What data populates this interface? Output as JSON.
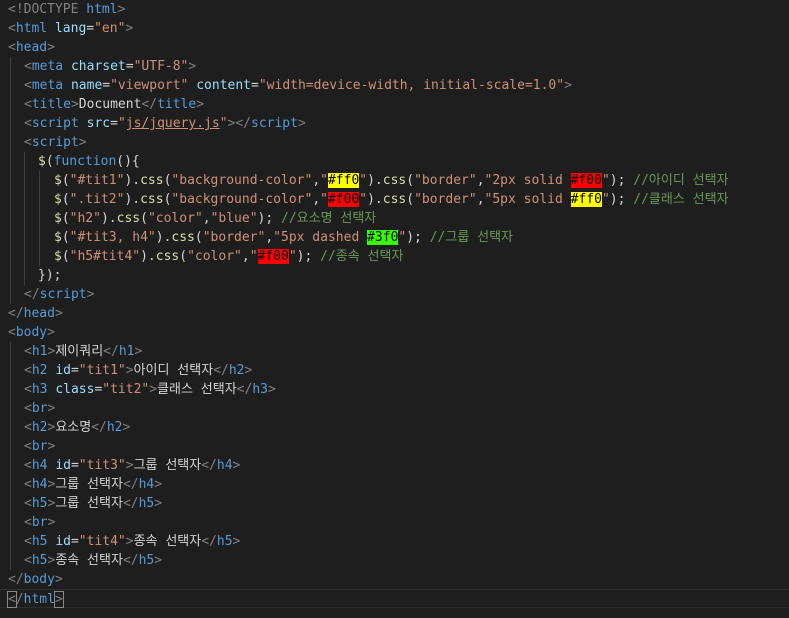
{
  "editor": {
    "lines": [
      [
        {
          "t": "<!DOCTYPE ",
          "c": "br"
        },
        {
          "t": "html",
          "c": "tag"
        },
        {
          "t": ">",
          "c": "br"
        }
      ],
      [
        {
          "t": "<",
          "c": "br"
        },
        {
          "t": "html",
          "c": "tag"
        },
        {
          "t": " ",
          "c": "txt"
        },
        {
          "t": "lang",
          "c": "attr"
        },
        {
          "t": "=",
          "c": "txt"
        },
        {
          "t": "\"en\"",
          "c": "str"
        },
        {
          "t": ">",
          "c": "br"
        }
      ],
      [
        {
          "t": "<",
          "c": "br"
        },
        {
          "t": "head",
          "c": "tag"
        },
        {
          "t": ">",
          "c": "br"
        }
      ],
      [
        {
          "t": "<",
          "c": "br"
        },
        {
          "t": "meta",
          "c": "tag"
        },
        {
          "t": " ",
          "c": "txt"
        },
        {
          "t": "charset",
          "c": "attr"
        },
        {
          "t": "=",
          "c": "txt"
        },
        {
          "t": "\"UTF-8\"",
          "c": "str"
        },
        {
          "t": ">",
          "c": "br"
        }
      ],
      [
        {
          "t": "<",
          "c": "br"
        },
        {
          "t": "meta",
          "c": "tag"
        },
        {
          "t": " ",
          "c": "txt"
        },
        {
          "t": "name",
          "c": "attr"
        },
        {
          "t": "=",
          "c": "txt"
        },
        {
          "t": "\"viewport\"",
          "c": "str"
        },
        {
          "t": " ",
          "c": "txt"
        },
        {
          "t": "content",
          "c": "attr"
        },
        {
          "t": "=",
          "c": "txt"
        },
        {
          "t": "\"width=device-width, initial-scale=1.0\"",
          "c": "str"
        },
        {
          "t": ">",
          "c": "br"
        }
      ],
      [
        {
          "t": "<",
          "c": "br"
        },
        {
          "t": "title",
          "c": "tag"
        },
        {
          "t": ">",
          "c": "br"
        },
        {
          "t": "Document",
          "c": "txt"
        },
        {
          "t": "</",
          "c": "br"
        },
        {
          "t": "title",
          "c": "tag"
        },
        {
          "t": ">",
          "c": "br"
        }
      ],
      [
        {
          "t": "<",
          "c": "br"
        },
        {
          "t": "script",
          "c": "tag"
        },
        {
          "t": " ",
          "c": "txt"
        },
        {
          "t": "src",
          "c": "attr"
        },
        {
          "t": "=",
          "c": "txt"
        },
        {
          "t": "\"",
          "c": "str"
        },
        {
          "t": "js/jquery.js",
          "c": "link"
        },
        {
          "t": "\"",
          "c": "str"
        },
        {
          "t": "></",
          "c": "br"
        },
        {
          "t": "script",
          "c": "tag"
        },
        {
          "t": ">",
          "c": "br"
        }
      ],
      [
        {
          "t": "<",
          "c": "br"
        },
        {
          "t": "script",
          "c": "tag"
        },
        {
          "t": ">",
          "c": "br"
        }
      ],
      [
        {
          "t": "$",
          "c": "fn"
        },
        {
          "t": "(",
          "c": "txt"
        },
        {
          "t": "function",
          "c": "kw"
        },
        {
          "t": "(){",
          "c": "txt"
        }
      ],
      [
        {
          "t": "$",
          "c": "fn"
        },
        {
          "t": "(",
          "c": "txt"
        },
        {
          "t": "\"#tit1\"",
          "c": "str"
        },
        {
          "t": ").",
          "c": "txt"
        },
        {
          "t": "css",
          "c": "fn"
        },
        {
          "t": "(",
          "c": "txt"
        },
        {
          "t": "\"background-color\"",
          "c": "str"
        },
        {
          "t": ",",
          "c": "txt"
        },
        {
          "t": "\"",
          "c": "str"
        },
        {
          "t": "#ff0",
          "c": "sw",
          "bg": "#ffff00",
          "fg": "#000000"
        },
        {
          "t": "\"",
          "c": "str"
        },
        {
          "t": ").",
          "c": "txt"
        },
        {
          "t": "css",
          "c": "fn"
        },
        {
          "t": "(",
          "c": "txt"
        },
        {
          "t": "\"border\"",
          "c": "str"
        },
        {
          "t": ",",
          "c": "txt"
        },
        {
          "t": "\"2px solid ",
          "c": "str"
        },
        {
          "t": "#f00",
          "c": "sw",
          "bg": "#ff0000",
          "fg": "#000000"
        },
        {
          "t": "\"",
          "c": "str"
        },
        {
          "t": "); ",
          "c": "txt"
        },
        {
          "t": "//아이디 선택자",
          "c": "cmt"
        }
      ],
      [
        {
          "t": "$",
          "c": "fn"
        },
        {
          "t": "(",
          "c": "txt"
        },
        {
          "t": "\".tit2\"",
          "c": "str"
        },
        {
          "t": ").",
          "c": "txt"
        },
        {
          "t": "css",
          "c": "fn"
        },
        {
          "t": "(",
          "c": "txt"
        },
        {
          "t": "\"background-color\"",
          "c": "str"
        },
        {
          "t": ",",
          "c": "txt"
        },
        {
          "t": "\"",
          "c": "str"
        },
        {
          "t": "#f00",
          "c": "sw",
          "bg": "#ff0000",
          "fg": "#000000"
        },
        {
          "t": "\"",
          "c": "str"
        },
        {
          "t": ").",
          "c": "txt"
        },
        {
          "t": "css",
          "c": "fn"
        },
        {
          "t": "(",
          "c": "txt"
        },
        {
          "t": "\"border\"",
          "c": "str"
        },
        {
          "t": ",",
          "c": "txt"
        },
        {
          "t": "\"5px solid ",
          "c": "str"
        },
        {
          "t": "#ff0",
          "c": "sw",
          "bg": "#ffff00",
          "fg": "#000000"
        },
        {
          "t": "\"",
          "c": "str"
        },
        {
          "t": "); ",
          "c": "txt"
        },
        {
          "t": "//클래스 선택자",
          "c": "cmt"
        }
      ],
      [
        {
          "t": "$",
          "c": "fn"
        },
        {
          "t": "(",
          "c": "txt"
        },
        {
          "t": "\"h2\"",
          "c": "str"
        },
        {
          "t": ").",
          "c": "txt"
        },
        {
          "t": "css",
          "c": "fn"
        },
        {
          "t": "(",
          "c": "txt"
        },
        {
          "t": "\"color\"",
          "c": "str"
        },
        {
          "t": ",",
          "c": "txt"
        },
        {
          "t": "\"blue\"",
          "c": "str"
        },
        {
          "t": "); ",
          "c": "txt"
        },
        {
          "t": "//요소명 선택자",
          "c": "cmt"
        }
      ],
      [
        {
          "t": "$",
          "c": "fn"
        },
        {
          "t": "(",
          "c": "txt"
        },
        {
          "t": "\"#tit3, h4\"",
          "c": "str"
        },
        {
          "t": ").",
          "c": "txt"
        },
        {
          "t": "css",
          "c": "fn"
        },
        {
          "t": "(",
          "c": "txt"
        },
        {
          "t": "\"border\"",
          "c": "str"
        },
        {
          "t": ",",
          "c": "txt"
        },
        {
          "t": "\"5px dashed ",
          "c": "str"
        },
        {
          "t": "#3f0",
          "c": "sw",
          "bg": "#33ff00",
          "fg": "#000000"
        },
        {
          "t": "\"",
          "c": "str"
        },
        {
          "t": "); ",
          "c": "txt"
        },
        {
          "t": "//그룹 선택자",
          "c": "cmt"
        }
      ],
      [
        {
          "t": "$",
          "c": "fn"
        },
        {
          "t": "(",
          "c": "txt"
        },
        {
          "t": "\"h5#tit4\"",
          "c": "str"
        },
        {
          "t": ").",
          "c": "txt"
        },
        {
          "t": "css",
          "c": "fn"
        },
        {
          "t": "(",
          "c": "txt"
        },
        {
          "t": "\"color\"",
          "c": "str"
        },
        {
          "t": ",",
          "c": "txt"
        },
        {
          "t": "\"",
          "c": "str"
        },
        {
          "t": "#f00",
          "c": "sw",
          "bg": "#ff0000",
          "fg": "#000000"
        },
        {
          "t": "\"",
          "c": "str"
        },
        {
          "t": "); ",
          "c": "txt"
        },
        {
          "t": "//종속 선택자",
          "c": "cmt"
        }
      ],
      [
        {
          "t": "});",
          "c": "txt"
        }
      ],
      [
        {
          "t": "</",
          "c": "br"
        },
        {
          "t": "script",
          "c": "tag"
        },
        {
          "t": ">",
          "c": "br"
        }
      ],
      [
        {
          "t": "</",
          "c": "br"
        },
        {
          "t": "head",
          "c": "tag"
        },
        {
          "t": ">",
          "c": "br"
        }
      ],
      [
        {
          "t": "<",
          "c": "br"
        },
        {
          "t": "body",
          "c": "tag"
        },
        {
          "t": ">",
          "c": "br"
        }
      ],
      [
        {
          "t": "<",
          "c": "br"
        },
        {
          "t": "h1",
          "c": "tag"
        },
        {
          "t": ">",
          "c": "br"
        },
        {
          "t": "제이쿼리",
          "c": "txt"
        },
        {
          "t": "</",
          "c": "br"
        },
        {
          "t": "h1",
          "c": "tag"
        },
        {
          "t": ">",
          "c": "br"
        }
      ],
      [
        {
          "t": "<",
          "c": "br"
        },
        {
          "t": "h2",
          "c": "tag"
        },
        {
          "t": " ",
          "c": "txt"
        },
        {
          "t": "id",
          "c": "attr"
        },
        {
          "t": "=",
          "c": "txt"
        },
        {
          "t": "\"tit1\"",
          "c": "str"
        },
        {
          "t": ">",
          "c": "br"
        },
        {
          "t": "아이디 선택자",
          "c": "txt"
        },
        {
          "t": "</",
          "c": "br"
        },
        {
          "t": "h2",
          "c": "tag"
        },
        {
          "t": ">",
          "c": "br"
        }
      ],
      [
        {
          "t": "<",
          "c": "br"
        },
        {
          "t": "h3",
          "c": "tag"
        },
        {
          "t": " ",
          "c": "txt"
        },
        {
          "t": "class",
          "c": "attr"
        },
        {
          "t": "=",
          "c": "txt"
        },
        {
          "t": "\"tit2\"",
          "c": "str"
        },
        {
          "t": ">",
          "c": "br"
        },
        {
          "t": "클래스 선택자",
          "c": "txt"
        },
        {
          "t": "</",
          "c": "br"
        },
        {
          "t": "h3",
          "c": "tag"
        },
        {
          "t": ">",
          "c": "br"
        }
      ],
      [
        {
          "t": "<",
          "c": "br"
        },
        {
          "t": "br",
          "c": "tag"
        },
        {
          "t": ">",
          "c": "br"
        }
      ],
      [
        {
          "t": "<",
          "c": "br"
        },
        {
          "t": "h2",
          "c": "tag"
        },
        {
          "t": ">",
          "c": "br"
        },
        {
          "t": "요소명",
          "c": "txt"
        },
        {
          "t": "</",
          "c": "br"
        },
        {
          "t": "h2",
          "c": "tag"
        },
        {
          "t": ">",
          "c": "br"
        }
      ],
      [
        {
          "t": "<",
          "c": "br"
        },
        {
          "t": "br",
          "c": "tag"
        },
        {
          "t": ">",
          "c": "br"
        }
      ],
      [
        {
          "t": "<",
          "c": "br"
        },
        {
          "t": "h4",
          "c": "tag"
        },
        {
          "t": " ",
          "c": "txt"
        },
        {
          "t": "id",
          "c": "attr"
        },
        {
          "t": "=",
          "c": "txt"
        },
        {
          "t": "\"tit3\"",
          "c": "str"
        },
        {
          "t": ">",
          "c": "br"
        },
        {
          "t": "그룹 선택자",
          "c": "txt"
        },
        {
          "t": "</",
          "c": "br"
        },
        {
          "t": "h4",
          "c": "tag"
        },
        {
          "t": ">",
          "c": "br"
        }
      ],
      [
        {
          "t": "<",
          "c": "br"
        },
        {
          "t": "h4",
          "c": "tag"
        },
        {
          "t": ">",
          "c": "br"
        },
        {
          "t": "그룹 선택자",
          "c": "txt"
        },
        {
          "t": "</",
          "c": "br"
        },
        {
          "t": "h4",
          "c": "tag"
        },
        {
          "t": ">",
          "c": "br"
        }
      ],
      [
        {
          "t": "<",
          "c": "br"
        },
        {
          "t": "h5",
          "c": "tag"
        },
        {
          "t": ">",
          "c": "br"
        },
        {
          "t": "그룹 선택자",
          "c": "txt"
        },
        {
          "t": "</",
          "c": "br"
        },
        {
          "t": "h5",
          "c": "tag"
        },
        {
          "t": ">",
          "c": "br"
        }
      ],
      [
        {
          "t": "<",
          "c": "br"
        },
        {
          "t": "br",
          "c": "tag"
        },
        {
          "t": ">",
          "c": "br"
        }
      ],
      [
        {
          "t": "<",
          "c": "br"
        },
        {
          "t": "h5",
          "c": "tag"
        },
        {
          "t": " ",
          "c": "txt"
        },
        {
          "t": "id",
          "c": "attr"
        },
        {
          "t": "=",
          "c": "txt"
        },
        {
          "t": "\"tit4\"",
          "c": "str"
        },
        {
          "t": ">",
          "c": "br"
        },
        {
          "t": "종속 선택자",
          "c": "txt"
        },
        {
          "t": "</",
          "c": "br"
        },
        {
          "t": "h5",
          "c": "tag"
        },
        {
          "t": ">",
          "c": "br"
        }
      ],
      [
        {
          "t": "<",
          "c": "br"
        },
        {
          "t": "h5",
          "c": "tag"
        },
        {
          "t": ">",
          "c": "br"
        },
        {
          "t": "종속 선택자",
          "c": "txt"
        },
        {
          "t": "</",
          "c": "br"
        },
        {
          "t": "h5",
          "c": "tag"
        },
        {
          "t": ">",
          "c": "br"
        }
      ],
      [
        {
          "t": "</",
          "c": "br"
        },
        {
          "t": "body",
          "c": "tag"
        },
        {
          "t": ">",
          "c": "br"
        }
      ],
      [
        {
          "t": "<",
          "c": "cur"
        },
        {
          "t": "/",
          "c": "br"
        },
        {
          "t": "html",
          "c": "tag"
        },
        {
          "t": ">",
          "c": "cur"
        }
      ]
    ]
  }
}
